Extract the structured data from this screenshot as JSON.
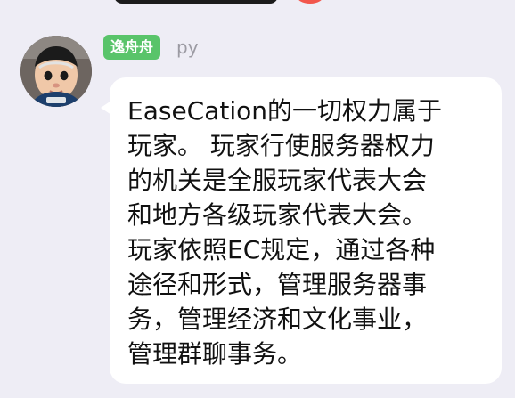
{
  "chat": {
    "message": {
      "sender_badge": "逸舟舟",
      "sender_name": "py",
      "lines": [
        "EaseCation的一切权力属于",
        "玩家。 玩家行使服务器权力",
        "的机关是全服玩家代表大会",
        "和地方各级玩家代表大会。",
        "玩家依照EC规定，通过各种",
        "途径和形式，管理服务器事",
        "务，管理经济和文化事业，",
        "管理群聊事务。"
      ]
    }
  },
  "colors": {
    "background": "#eeedf5",
    "bubble": "#ffffff",
    "sender_badge": "#59c46a",
    "sender_name": "#9c9ba3",
    "message_text": "#111111"
  },
  "icons": {
    "avatar": "child-avatar"
  }
}
